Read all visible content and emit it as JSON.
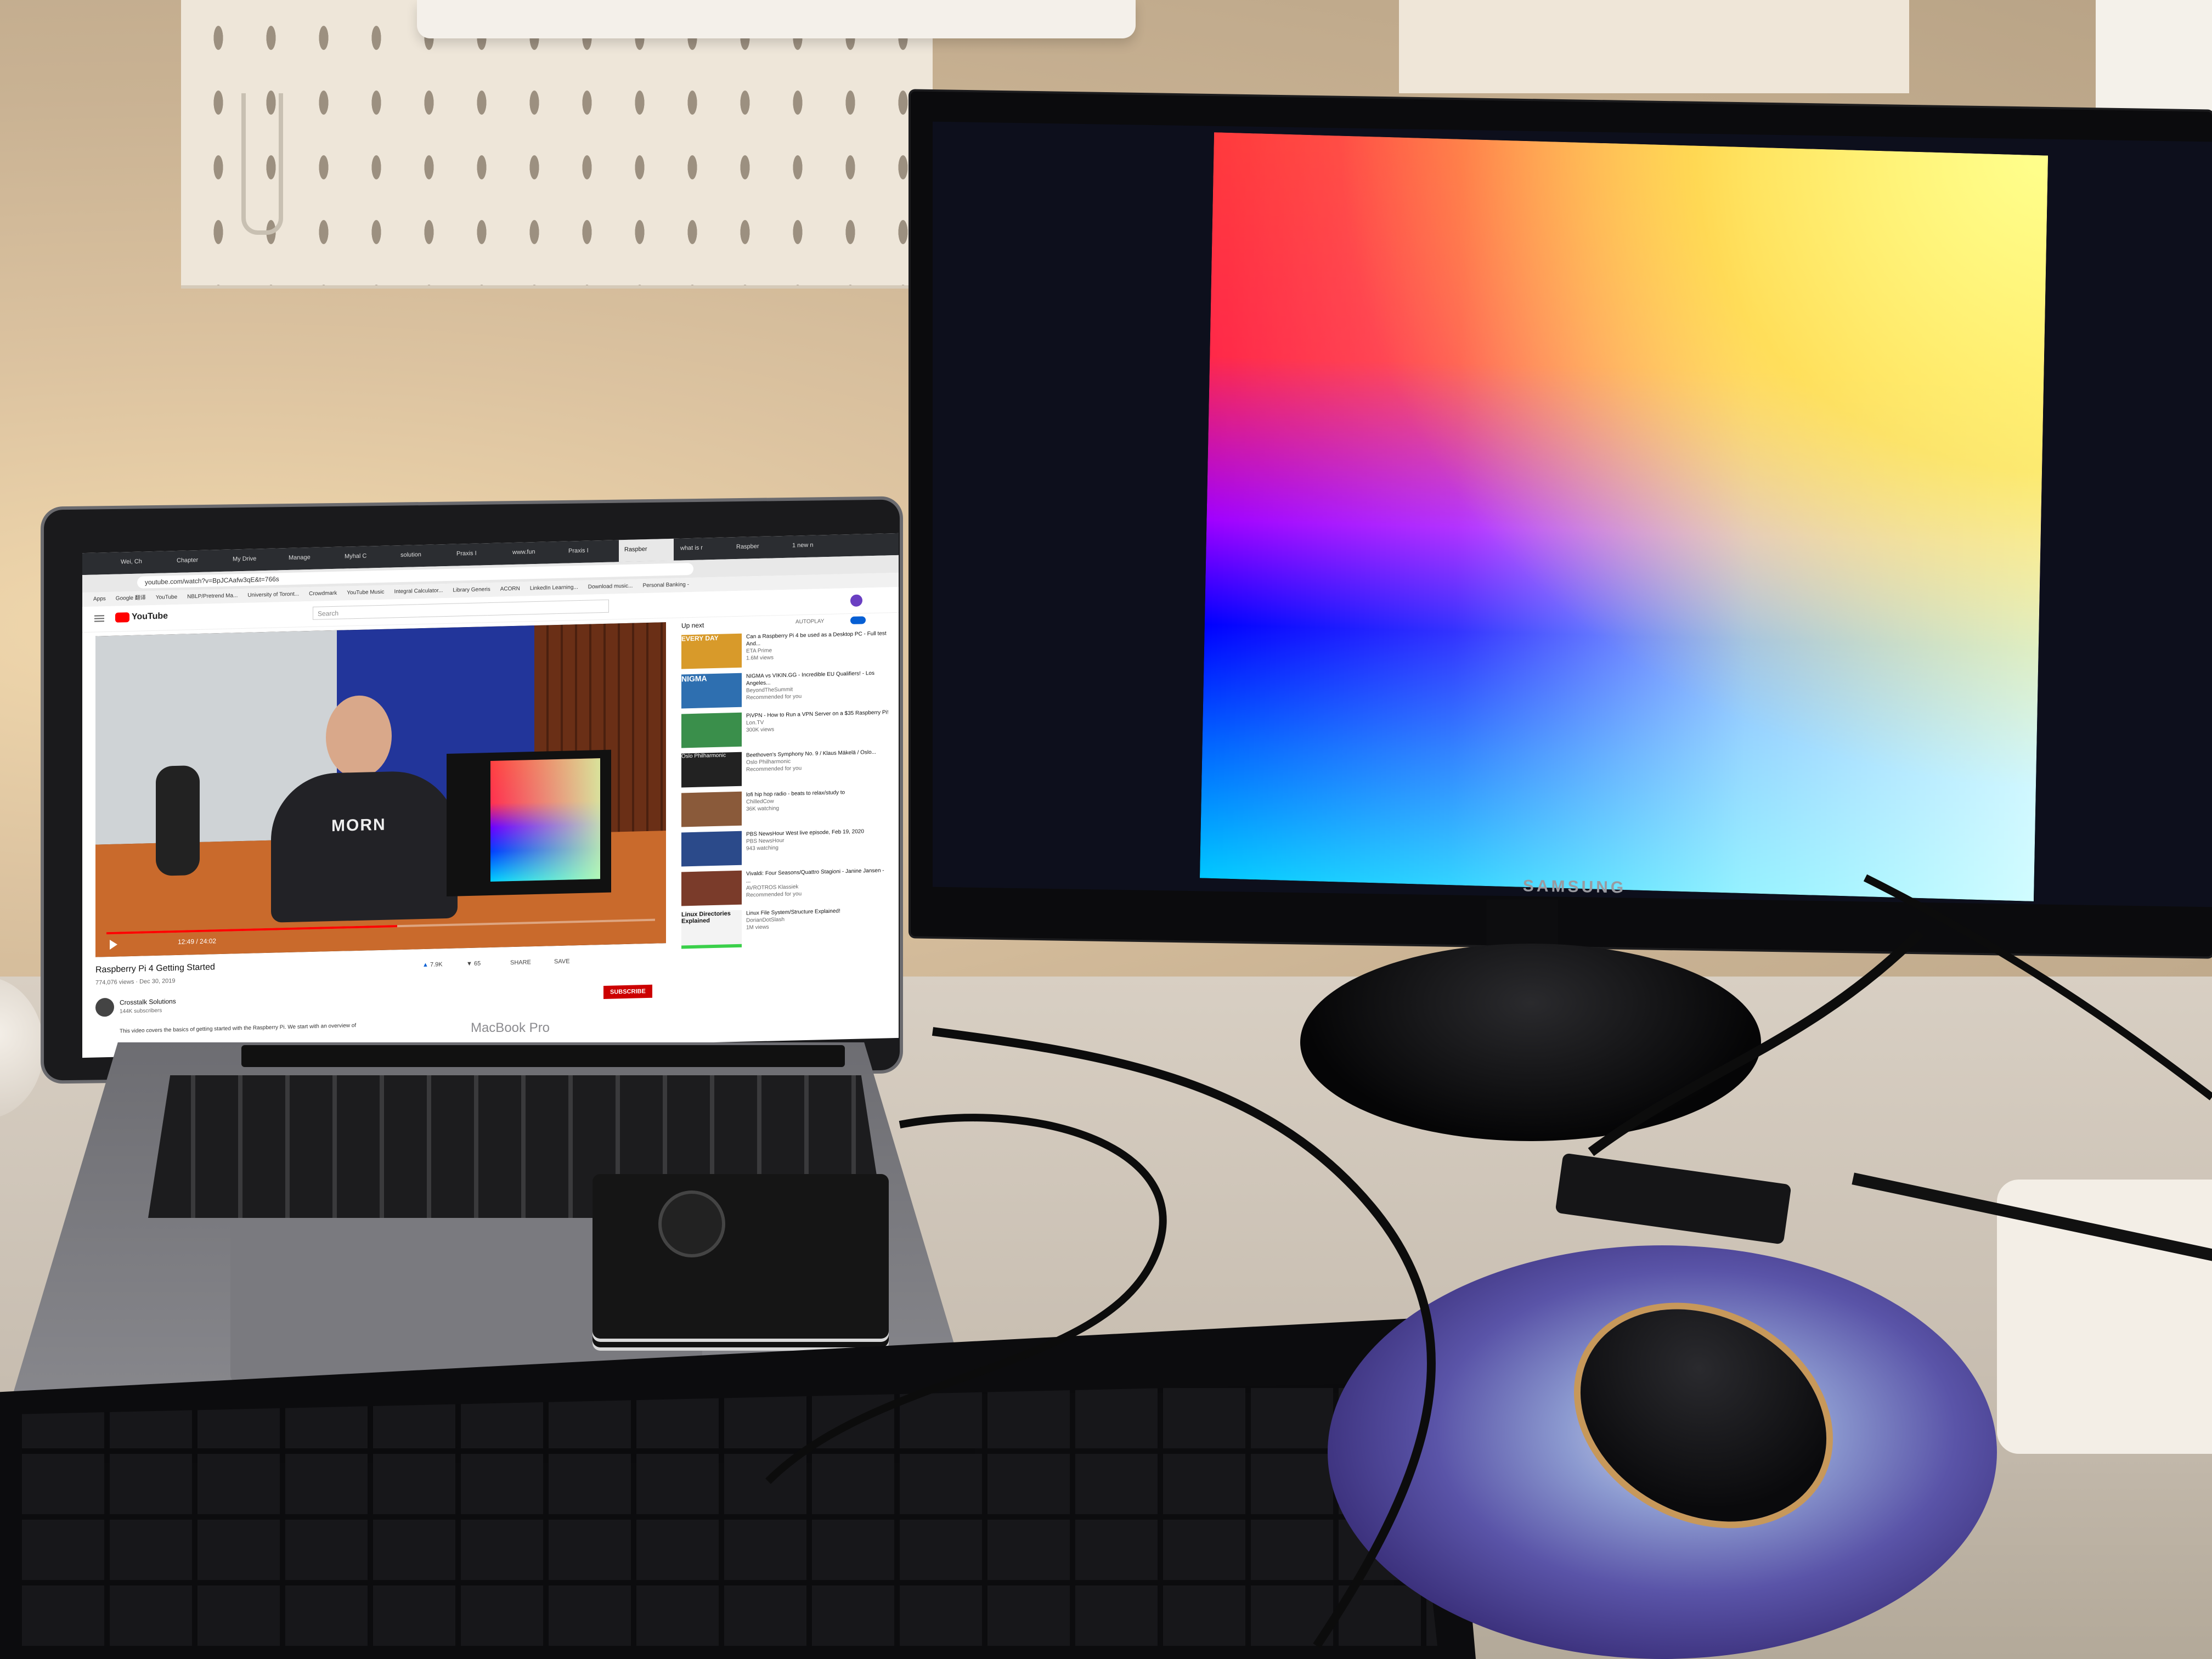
{
  "scene": {
    "description_free": true
  },
  "laptop": {
    "brand_label": "MacBook Pro",
    "browser": {
      "tabs": [
        "Wei, Ch",
        "Chapter",
        "My Drive",
        "Manage",
        "Myhal C",
        "solution",
        "Praxis I",
        "www.fun",
        "Praxis I",
        "Raspber",
        "what is r",
        "Raspber",
        "1 new n"
      ],
      "url": "youtube.com/watch?v=BpJCAafw3qE&t=766s",
      "bookmarks": [
        "Apps",
        "Google 翻译",
        "YouTube",
        "NBLP/Pretrend Ma...",
        "University of Toront...",
        "Crowdmark",
        "YouTube Music",
        "Integral Calculator...",
        "Library Generis",
        "ACORN",
        "LinkedIn Learning...",
        "Download music...",
        "Personal Banking -"
      ]
    },
    "youtube": {
      "logo": "YouTube",
      "search_placeholder": "Search",
      "up_next_label": "Up next",
      "autoplay_label": "AUTOPLAY",
      "video_title": "Raspberry Pi 4 Getting Started",
      "video_meta": "774,076 views · Dec 30, 2019",
      "like_count": "7.9K",
      "dislike_count": "65",
      "share_label": "SHARE",
      "save_label": "SAVE",
      "subscribe_label": "SUBSCRIBE",
      "channel_name": "Crosstalk Solutions",
      "channel_subs": "144K subscribers",
      "description": "This video covers the basics of getting started with the Raspberry Pi. We start with an overview of",
      "time_display": "12:49 / 24:02",
      "shirt_text": "MORN",
      "sidebar": [
        {
          "thumb_label": "EVERY DAY",
          "title": "Can a Raspberry Pi 4 be used as a Desktop PC - Full test And...",
          "channel": "ETA Prime",
          "meta": "1.6M views",
          "color": "#d89a2a"
        },
        {
          "thumb_label": "NIGMA",
          "title": "NIGMA vs VIKIN.GG - Incredible EU Qualifiers! - Los Angeles...",
          "channel": "BeyondTheSummit",
          "meta": "Recommended for you",
          "color": "#2e6fb0"
        },
        {
          "thumb_label": "",
          "title": "PiVPN - How to Run a VPN Server on a $35 Raspberry Pi!",
          "channel": "Lon.TV",
          "meta": "300K views",
          "color": "#3a8f4b"
        },
        {
          "thumb_label": "Oslo Philharmonic",
          "title": "Beethoven's Symphony No. 9 / Klaus Mäkelä / Oslo...",
          "channel": "Oslo Philharmonic",
          "meta": "Recommended for you",
          "color": "#222222"
        },
        {
          "thumb_label": "",
          "title": "lofi hip hop radio - beats to relax/study to",
          "channel": "ChilledCow",
          "meta": "36K watching",
          "color": "#8a5a3a"
        },
        {
          "thumb_label": "",
          "title": "PBS NewsHour West live episode, Feb 19, 2020",
          "channel": "PBS NewsHour",
          "meta": "943 watching",
          "color": "#2b4a8a"
        },
        {
          "thumb_label": "",
          "title": "Vivaldi: Four Seasons/Quattro Stagioni - Janine Jansen - ...",
          "channel": "AVROTROS Klassiek",
          "meta": "Recommended for you",
          "color": "#7a3b2a"
        },
        {
          "thumb_label": "Linux Directories Explained",
          "title": "Linux File System/Structure Explained!",
          "channel": "DorianDotSlash",
          "meta": "1M views",
          "color": "#f3f3f3"
        }
      ]
    }
  },
  "monitor": {
    "brand_label": "SAMSUNG"
  },
  "colors": {
    "wall": "#d8c5a6",
    "desk": "#cdc2b4",
    "monitor_bezel": "#111111",
    "screen_black": "#0d0d10"
  }
}
